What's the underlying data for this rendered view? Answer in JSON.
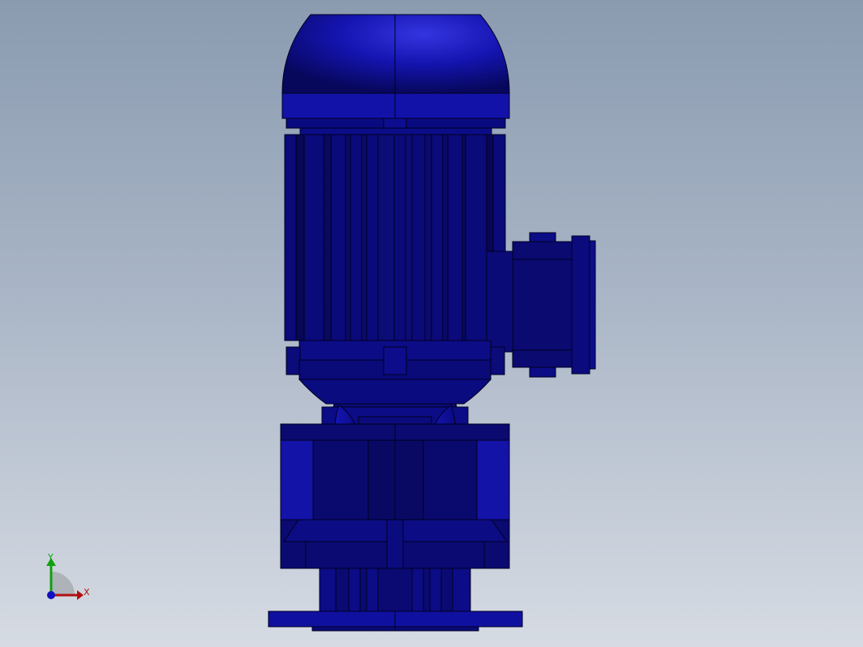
{
  "viewport": {
    "background_top": "#8a9bb0",
    "background_bottom": "#d6dbe3"
  },
  "model": {
    "part_color": "#0b0b73",
    "highlight_color": "#2a2ad0",
    "edge_color": "#000033"
  },
  "triad": {
    "x_label": "X",
    "y_label": "Y",
    "x_color": "#b01010",
    "y_color": "#10a010",
    "z_color": "#1010c0"
  }
}
